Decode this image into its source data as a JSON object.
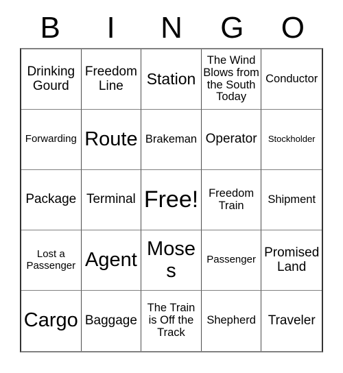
{
  "card": {
    "header_letters": [
      "B",
      "I",
      "N",
      "G",
      "O"
    ],
    "columns": 5,
    "rows": 5,
    "free_space_label": "Free!",
    "free_space_position": "center",
    "colors": {
      "background": "#ffffff",
      "text": "#000000",
      "grid_line": "#4d4d4d",
      "grid_line_light": "#808080"
    },
    "cells": [
      [
        {
          "text": "Drinking Gourd",
          "size": "lg"
        },
        {
          "text": "Freedom Line",
          "size": "lg"
        },
        {
          "text": "Station",
          "size": "xl"
        },
        {
          "text": "The Wind Blows from the South Today",
          "size": "md"
        },
        {
          "text": "Conductor",
          "size": "md"
        }
      ],
      [
        {
          "text": "Forwarding",
          "size": "sm"
        },
        {
          "text": "Route",
          "size": "xxl"
        },
        {
          "text": "Brakeman",
          "size": "md"
        },
        {
          "text": "Operator",
          "size": "lg"
        },
        {
          "text": "Stockholder",
          "size": "xs"
        }
      ],
      [
        {
          "text": "Package",
          "size": "lg"
        },
        {
          "text": "Terminal",
          "size": "lg"
        },
        {
          "text": "Free!",
          "size": "free"
        },
        {
          "text": "Freedom Train",
          "size": "md"
        },
        {
          "text": "Shipment",
          "size": "md"
        }
      ],
      [
        {
          "text": "Lost a Passenger",
          "size": "sm"
        },
        {
          "text": "Agent",
          "size": "xxl"
        },
        {
          "text": "Moses",
          "size": "xxl"
        },
        {
          "text": "Passenger",
          "size": "sm"
        },
        {
          "text": "Promised Land",
          "size": "lg"
        }
      ],
      [
        {
          "text": "Cargo",
          "size": "xxl"
        },
        {
          "text": "Baggage",
          "size": "lg"
        },
        {
          "text": "The Train is Off the Track",
          "size": "md"
        },
        {
          "text": "Shepherd",
          "size": "md"
        },
        {
          "text": "Traveler",
          "size": "lg"
        }
      ]
    ]
  }
}
